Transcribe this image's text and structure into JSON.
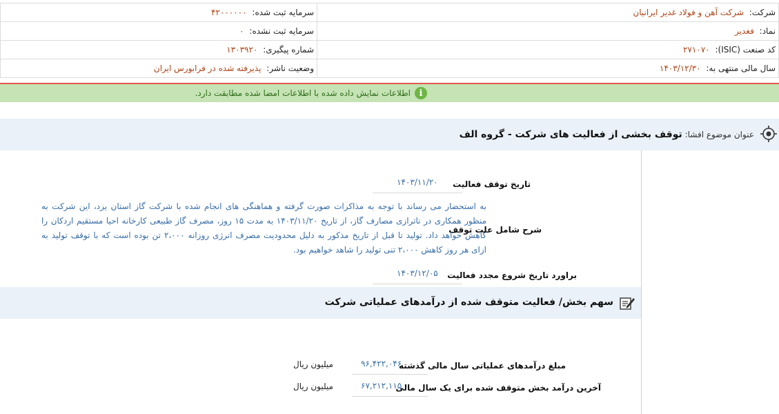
{
  "header": {
    "company_label": "شرکت:",
    "company_value": "شرکت آهن و فولاد غدیر ایرانیان",
    "capital_registered_label": "سرمایه ثبت شده:",
    "capital_registered_value": "۴۲۰۰۰۰۰۰",
    "symbol_label": "نماد:",
    "symbol_value": "فغدیر",
    "capital_unregistered_label": "سرمایه ثبت نشده:",
    "capital_unregistered_value": "۰",
    "isic_label": "کد صنعت (ISIC):",
    "isic_value": "۲۷۱۰۷۰",
    "tracking_label": "شماره پیگیری:",
    "tracking_value": "۱۳۰۳۹۲۰",
    "fiscal_label": "سال مالی منتهی به:",
    "fiscal_value": "۱۴۰۳/۱۲/۳۰",
    "status_label": "وضعیت ناشر:",
    "status_value": "پذیرفته شده در فرابورس ایران"
  },
  "alert": {
    "icon": "info-icon",
    "text": "اطلاعات نمایش داده شده با اطلاعات امضا شده مطابقت دارد."
  },
  "subject": {
    "icon": "target-icon",
    "label": "عنوان موضوع افشا:",
    "title": "توقف بخشی از فعالیت های شرکت - گروه الف"
  },
  "details": {
    "stop_date_label": "تاریخ توقف فعالیت",
    "stop_date_value": "۱۴۰۳/۱۱/۲۰",
    "reason_label": "شرح شامل علت توقف",
    "reason_value": "به استحضار می رساند با توجه به مذاکرات صورت گرفته و هماهنگی های انجام شده با شرکت گاز استان یزد، این شرکت به منظور همکاری در ناترازی مصارف گاز، از تاریخ ۱۴۰۳/۱۱/۲۰ به مدت ۱۵ روز، مصرف گاز طبیعی کارخانه احیا مستقیم اردکان را کاهش خواهد داد. تولید تا قبل از تاریخ مذکور به دلیل محدودیت مصرف انرژی روزانه ۲،۰۰۰ تن بوده است که با توقف تولید به ازای هر روز کاهش ۲،۰۰۰ تنی تولید را شاهد خواهیم بود.",
    "restart_label": "براورد تاریخ شروع مجدد فعالیت",
    "restart_value": "۱۴۰۳/۱۲/۰۵"
  },
  "share_section": {
    "icon": "edit-icon",
    "title": "سهم بخش/ فعالیت متوقف شده از درآمدهای عملیاتی شرکت",
    "prev_revenue_label": "مبلغ درآمدهای عملیاتی سال مالی گذشته",
    "prev_revenue_value": "۹۶,۴۲۲,۰۴۶",
    "prev_revenue_unit": "میلیون ریال",
    "last_revenue_label": "آخرین درآمد بخش متوقف شده برای یک سال مالی",
    "last_revenue_value": "۶۷,۲۱۲,۱۱۵",
    "last_revenue_unit": "میلیون ریال"
  },
  "colors": {
    "value_orange": "#b0441a",
    "value_blue": "#3a6ea8",
    "alert_bg": "#c5e3b4",
    "alert_line": "#e05a4e",
    "section_bg": "#eaf1f8"
  }
}
